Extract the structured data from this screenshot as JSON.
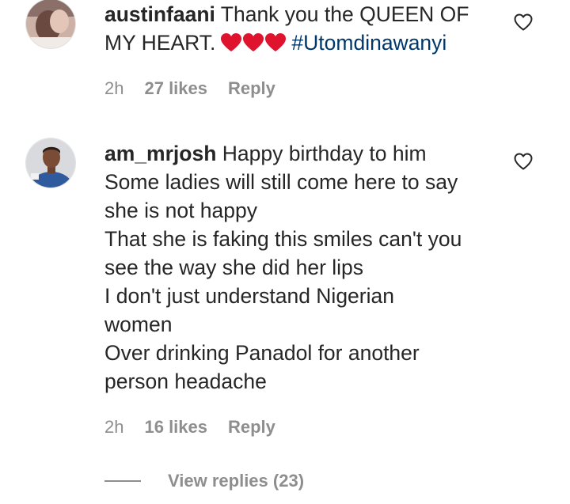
{
  "comments": [
    {
      "username": "austinfaani",
      "text_line1": "Thank you the QUEEN OF",
      "text_line2": "MY HEART.",
      "hearts": 3,
      "hashtag": "#Utomdinawanyi",
      "time": "2h",
      "likes": "27 likes",
      "reply": "Reply",
      "icons": {
        "like": "heart-outline-icon",
        "hearts": "red-heart-emoji"
      },
      "colors": {
        "heart": "#e0132f",
        "hashtag": "#00376b"
      }
    },
    {
      "username": "am_mrjosh",
      "lines": [
        "Happy birthday to him",
        "Some ladies will still come here to say",
        "she is not happy",
        "That she is faking this smiles can't you",
        "see the way she did her lips",
        "I don't just understand Nigerian",
        "women",
        "Over drinking Panadol for another",
        "person headache"
      ],
      "time": "2h",
      "likes": "16 likes",
      "reply": "Reply",
      "icons": {
        "like": "heart-outline-icon"
      }
    }
  ],
  "view_replies": "View replies (23)",
  "colors": {
    "text": "#262626",
    "meta": "#8e8e8e"
  }
}
